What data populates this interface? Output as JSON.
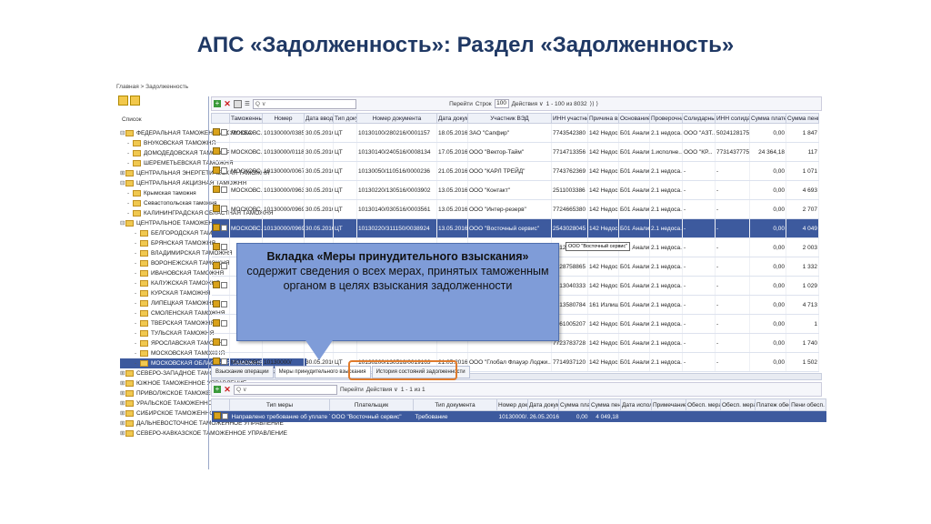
{
  "slide": {
    "title": "АПС «Задолженность»: Раздел «Задолженность»"
  },
  "breadcrumb": "Главная > Задолженность",
  "tree": {
    "label": "Список",
    "items": [
      {
        "text": "ФЕДЕРАЛЬНАЯ ТАМОЖЕННАЯ СЛУЖБА",
        "level": 0,
        "exp": "⊟"
      },
      {
        "text": "ВНУКОВСКАЯ ТАМОЖНЯ",
        "level": 1,
        "exp": "-"
      },
      {
        "text": "ДОМОДЕДОВСКАЯ ТАМОЖНЯ",
        "level": 1,
        "exp": "-"
      },
      {
        "text": "ШЕРЕМЕТЬЕВСКАЯ ТАМОЖНЯ",
        "level": 1,
        "exp": "-"
      },
      {
        "text": "ЦЕНТРАЛЬНАЯ ЭНЕРГЕТИЧЕСКАЯ ТАМОЖНЯ",
        "level": 0,
        "exp": "⊞"
      },
      {
        "text": "ЦЕНТРАЛЬНАЯ АКЦИЗНАЯ ТАМОЖНЯ",
        "level": 0,
        "exp": "⊟"
      },
      {
        "text": "Крымская таможня",
        "level": 1,
        "exp": "-"
      },
      {
        "text": "Севастопольская таможня",
        "level": 1,
        "exp": "-"
      },
      {
        "text": "КАЛИНИНГРАДСКАЯ ОБЛАСТНАЯ ТАМОЖНЯ",
        "level": 1,
        "exp": "-"
      },
      {
        "text": "ЦЕНТРАЛЬНОЕ ТАМОЖЕННОЕ УПРАВЛЕНИЕ",
        "level": 0,
        "exp": "⊟"
      },
      {
        "text": "БЕЛГОРОДСКАЯ ТАМОЖНЯ",
        "level": 2,
        "exp": "-"
      },
      {
        "text": "БРЯНСКАЯ ТАМОЖНЯ",
        "level": 2,
        "exp": "-"
      },
      {
        "text": "ВЛАДИМИРСКАЯ ТАМОЖНЯ",
        "level": 2,
        "exp": "-"
      },
      {
        "text": "ВОРОНЕЖСКАЯ ТАМОЖНЯ",
        "level": 2,
        "exp": "-"
      },
      {
        "text": "ИВАНОВСКАЯ ТАМОЖНЯ",
        "level": 2,
        "exp": "-"
      },
      {
        "text": "КАЛУЖСКАЯ ТАМОЖНЯ",
        "level": 2,
        "exp": "-"
      },
      {
        "text": "КУРСКАЯ ТАМОЖНЯ",
        "level": 2,
        "exp": "-"
      },
      {
        "text": "ЛИПЕЦКАЯ ТАМОЖНЯ",
        "level": 2,
        "exp": "-"
      },
      {
        "text": "СМОЛЕНСКАЯ ТАМОЖНЯ",
        "level": 2,
        "exp": "-"
      },
      {
        "text": "ТВЕРСКАЯ ТАМОЖНЯ",
        "level": 2,
        "exp": "-"
      },
      {
        "text": "ТУЛЬСКАЯ ТАМОЖНЯ",
        "level": 2,
        "exp": "-"
      },
      {
        "text": "ЯРОСЛАВСКАЯ ТАМОЖНЯ",
        "level": 2,
        "exp": "-"
      },
      {
        "text": "МОСКОВСКАЯ ТАМОЖНЯ",
        "level": 2,
        "exp": "-"
      },
      {
        "text": "МОСКОВСКАЯ ОБЛАСТНАЯ ТАМОЖНЯ",
        "level": 2,
        "exp": "-",
        "selected": true
      },
      {
        "text": "СЕВЕРО-ЗАПАДНОЕ ТАМОЖЕННОЕ УПРАВЛЕНИЕ",
        "level": 0,
        "exp": "⊞"
      },
      {
        "text": "ЮЖНОЕ ТАМОЖЕННОЕ УПРАВЛЕНИЕ",
        "level": 0,
        "exp": "⊞"
      },
      {
        "text": "ПРИВОЛЖСКОЕ ТАМОЖЕННОЕ УПРАВЛЕНИЕ",
        "level": 0,
        "exp": "⊞"
      },
      {
        "text": "УРАЛЬСКОЕ ТАМОЖЕННОЕ УПРАВЛЕНИЕ",
        "level": 0,
        "exp": "⊞"
      },
      {
        "text": "СИБИРСКОЕ ТАМОЖЕННОЕ УПРАВЛЕНИЕ",
        "level": 0,
        "exp": "⊞"
      },
      {
        "text": "ДАЛЬНЕВОСТОЧНОЕ ТАМОЖЕННОЕ УПРАВЛЕНИЕ",
        "level": 0,
        "exp": "⊞"
      },
      {
        "text": "СЕВЕРО-КАВКАЗСКОЕ ТАМОЖЕННОЕ УПРАВЛЕНИЕ",
        "level": 0,
        "exp": "⊞"
      }
    ]
  },
  "toolbar": {
    "search_placeholder": "Q ∨",
    "goto_label": "Перейти",
    "page_label": "Строк",
    "page_value": "100",
    "actions_label": "Действия ∨",
    "range_label": "1 - 100 из 8032"
  },
  "main_table": {
    "headers": [
      "",
      "Таможенный",
      "Номер",
      "Дата ввода",
      "Тип докуме",
      "Номер документа",
      "Дата докуме",
      "Участник ВЭД",
      "ИНН участника",
      "Причина взы",
      "Основание ц",
      "Проверочная",
      "Солидарные",
      "ИНН солидарн",
      "Сумма платежа",
      "Сумма пени"
    ],
    "rows": [
      [
        "МОСКОВС...",
        "10130000/0385",
        "30.05.2016",
        "ЦТ",
        "10130100/280216/0001157",
        "18.05.2016",
        "ЗАО \"Сапфир\"",
        "7743542380",
        "142 Недос...",
        "Б01 Анали...",
        "2.1 недоса...",
        "ООО \"АЗТ...",
        "5024128175",
        "0,00",
        "1 847"
      ],
      [
        "МОСКОВС...",
        "10130000/0118",
        "30.05.2016",
        "ЦТ",
        "10130140/240516/0008134",
        "17.05.2016",
        "ООО \"Вектор-Тайм\"",
        "7714713356",
        "142 Недос...",
        "Б01 Анали...",
        "1.исполне...",
        "ООО \"КР...",
        "7731437775",
        "24 364,18",
        "117"
      ],
      [
        "МОСКОВС...",
        "10130000/0067",
        "30.05.2016",
        "ЦТ",
        "10130050/110516/0000236",
        "21.05.2016",
        "ООО \"КАРЛ ТРЕЙД\"",
        "7743762369",
        "142 Недос...",
        "Б01 Анали...",
        "2.1 недоса...",
        "-",
        "-",
        "0,00",
        "1 071"
      ],
      [
        "МОСКОВС...",
        "10130000/0963",
        "30.05.2016",
        "ЦТ",
        "10130220/130516/0003902",
        "13.05.2016",
        "ООО \"Контакт\"",
        "2511003386",
        "142 Недос...",
        "Б01 Анали...",
        "2.1 недоса...",
        "-",
        "-",
        "0,00",
        "4 693"
      ],
      [
        "МОСКОВС...",
        "10130000/0969",
        "30.05.2016",
        "ЦТ",
        "10130140/030516/0003561",
        "13.05.2016",
        "ООО \"Интер-резерв\"",
        "7724665380",
        "142 Недос...",
        "Б01 Анали...",
        "2.1 недоса...",
        "-",
        "-",
        "0,00",
        "2 707"
      ],
      [
        "МОСКОВС...",
        "10130000/0969",
        "30.05.2016",
        "ЦТ",
        "10130220/311150/0038924",
        "13.05.2016",
        "ООО \"Восточный сервис\"",
        "2543028045",
        "142 Недос...",
        "Б01 Анали...",
        "2.1 недоса...",
        "-",
        "-",
        "0,00",
        "4 049"
      ],
      [
        "",
        "",
        "",
        "",
        "",
        "",
        "",
        "7712366571",
        "142 Недос...",
        "Б01 Анали...",
        "2.1 недоса...",
        "-",
        "-",
        "0,00",
        "2 003"
      ],
      [
        "",
        "",
        "",
        "",
        "",
        "",
        "",
        "7728758865",
        "142 Недос...",
        "Б01 Анали...",
        "2.1 недоса...",
        "-",
        "-",
        "0,00",
        "1 332"
      ],
      [
        "",
        "",
        "",
        "",
        "",
        "",
        "",
        "5013040333",
        "142 Недос...",
        "Б01 Анали...",
        "2.1 недоса...",
        "-",
        "-",
        "0,00",
        "1 029"
      ],
      [
        "",
        "",
        "",
        "",
        "",
        "",
        "",
        "7713580784",
        "161 Излиш...",
        "Б01 Анали...",
        "2.1 недоса...",
        "-",
        "-",
        "0,00",
        "4 713"
      ],
      [
        "",
        "",
        "",
        "",
        "",
        "",
        "...курр\"",
        "5961005207",
        "142 Недос...",
        "Б01 Анали...",
        "2.1 недоса...",
        "-",
        "-",
        "0,00",
        "1"
      ],
      [
        "",
        "",
        "",
        "",
        "",
        "",
        "",
        "7723783728",
        "142 Недос...",
        "Б01 Анали...",
        "2.1 недоса...",
        "-",
        "-",
        "0,00",
        "1 740"
      ],
      [
        "МОСКОВС...",
        "10130000/",
        "30.05.2016",
        "ЦТ",
        "10130200/130516/0019163",
        "21.05.2016",
        "ООО \"Глобал Флауэр Лоджи...",
        "7714937120",
        "142 Недос...",
        "Б01 Анали...",
        "2.1 недоса...",
        "-",
        "-",
        "0,00",
        "1 502"
      ]
    ],
    "selected_row": 5
  },
  "tooltip": "ООО \"Восточный сервис\"",
  "subtabs": [
    "Взыскание операции",
    "Меры принудительного взыскания",
    "История состояний задолженности"
  ],
  "active_subtab": 1,
  "sub_toolbar": {
    "search_placeholder": "Q ∨",
    "goto_label": "Перейти",
    "actions_label": "Действия ∨",
    "range_label": "1 - 1 из 1"
  },
  "sub_table": {
    "headers": [
      "",
      "Тип меры",
      "Плательщик",
      "Тип документа",
      "Номер докум",
      "Дата докуме",
      "Сумма платеж",
      "Сумма пени",
      "Дата исполне",
      "Примечание",
      "Обесп. мера",
      "Обесп. мера",
      "Платеж обес",
      "Пени обесп."
    ],
    "rows": [
      [
        "",
        "Направлено требование об уплате ТП",
        "ООО \"Восточный сервис\"",
        "Требование",
        "10130000/...",
        "26.05.2016",
        "0,00",
        "4 049,18",
        "",
        "",
        "",
        "",
        "",
        ""
      ]
    ]
  },
  "callout": {
    "heading": "Вкладка «Меры принудительного взыскания»",
    "text": "содержит сведения о всех мерах, принятых таможенным органом в целях взыскания задолженности"
  },
  "colors": {
    "title": "#1f3864",
    "selected_row": "#3d5a9e",
    "callout": "#7f9cd8",
    "highlight": "#e07b2c"
  }
}
